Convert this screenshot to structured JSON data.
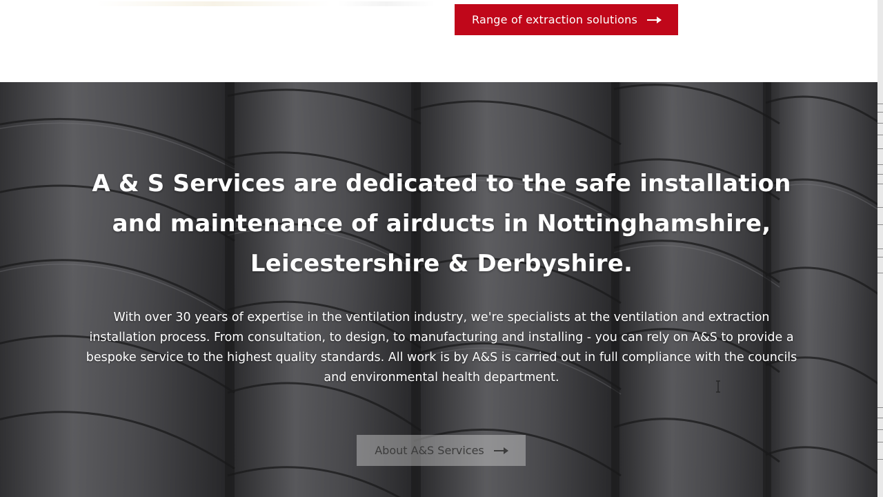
{
  "top": {
    "button_label": "Range of extraction solutions",
    "button_icon": "arrow-right-icon",
    "button_color": "#c0071a"
  },
  "hero": {
    "headline": "A & S Services are dedicated to the safe installation and maintenance of airducts in Nottinghamshire, Leicestershire & Derbyshire.",
    "body": "With over 30 years of expertise in the ventilation industry, we're specialists at the ventilation and extraction installation process. From consultation, to design, to manufacturing and installing - you can rely on A&S to provide a bespoke service to the highest quality standards. All work is by A&S is carried out in full compliance with the councils and environmental health department.",
    "button_label": "About A&S Services",
    "button_icon": "arrow-right-icon",
    "background": "spiral-duct-pipes-image"
  }
}
